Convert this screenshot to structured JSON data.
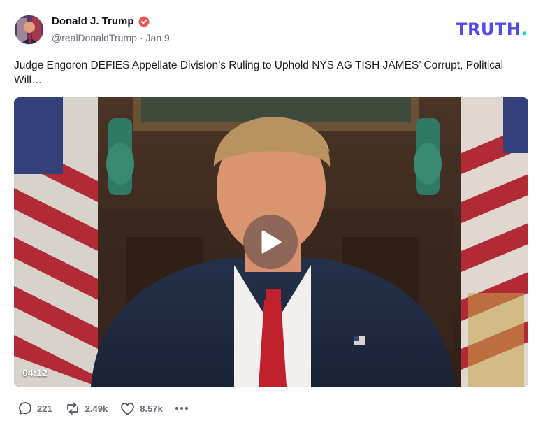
{
  "post": {
    "author": {
      "display_name": "Donald J. Trump",
      "verified": true,
      "handle": "@realDonaldTrump",
      "separator": "·",
      "date": "Jan 9"
    },
    "brand": {
      "name": "TRUTH",
      "dot": "."
    },
    "text": "Judge Engoron DEFIES Appellate Division’s Ruling to Uphold NYS AG TISH JAMES’ Corrupt, Political Will…",
    "media": {
      "type": "video",
      "duration": "04:12"
    },
    "stats": {
      "replies": "221",
      "retruths": "2.49k",
      "likes": "8.57k"
    }
  },
  "colors": {
    "brand": "#5448EE",
    "brand_accent": "#18D6B9",
    "verified_badge": "#E5595B",
    "muted_text": "#6A6F78"
  },
  "icons": {
    "verified": "verified-badge-icon",
    "play": "play-icon",
    "reply": "reply-icon",
    "retruth": "retruth-icon",
    "like": "heart-icon",
    "more": "more-dots-icon"
  }
}
